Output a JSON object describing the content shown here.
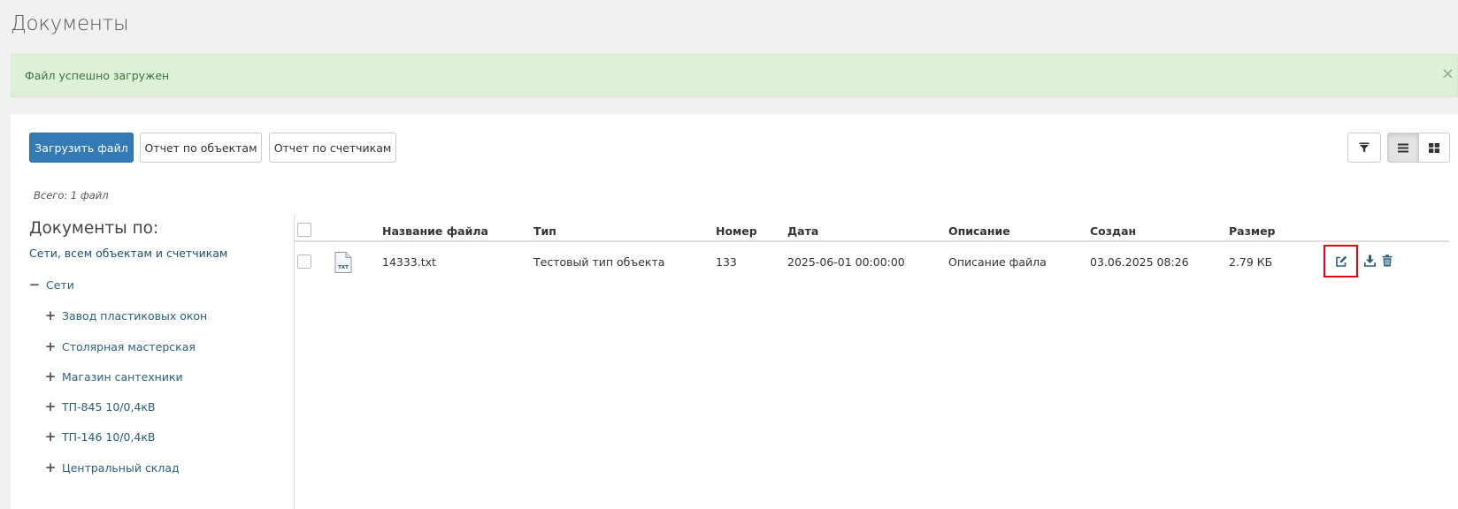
{
  "page": {
    "title": "Документы"
  },
  "alert": {
    "message": "Файл успешно загружен",
    "close": "×"
  },
  "toolbar": {
    "upload_label": "Загрузить файл",
    "report_objects_label": "Отчет по объектам",
    "report_counters_label": "Отчет по счетчикам"
  },
  "summary": {
    "total": "Всего: 1 файл"
  },
  "sidebar": {
    "title": "Документы по:",
    "root": "Сети, всем объектам и счетчикам",
    "group": {
      "toggle": "−",
      "label": "Сети"
    },
    "children": [
      {
        "toggle": "+",
        "label": "Завод пластиковых окон"
      },
      {
        "toggle": "+",
        "label": "Столярная мастерская"
      },
      {
        "toggle": "+",
        "label": "Магазин сантехники"
      },
      {
        "toggle": "+",
        "label": "ТП-845 10/0,4кВ"
      },
      {
        "toggle": "+",
        "label": "ТП-146 10/0,4кВ"
      },
      {
        "toggle": "+",
        "label": "Центральный склад"
      }
    ]
  },
  "table": {
    "columns": [
      "Название файла",
      "Тип",
      "Номер",
      "Дата",
      "Описание",
      "Создан",
      "Размер"
    ],
    "rows": [
      {
        "icon_label": "TXT",
        "name": "14333.txt",
        "type": "Тестовый тип объекта",
        "number": "133",
        "date": "2025-06-01 00:00:00",
        "description": "Описание файла",
        "created": "03.06.2025 08:26",
        "size": "2.79 КБ"
      }
    ]
  },
  "colors": {
    "primary": "#337ab7",
    "link": "#2c5f7c",
    "alert_bg": "#dff0d8",
    "alert_text": "#3c763d",
    "highlight": "#e5000f"
  },
  "icons": {
    "filter": "filter-icon",
    "list": "list-view-icon",
    "grid": "grid-view-icon",
    "edit": "edit-icon",
    "download": "download-icon",
    "delete": "trash-icon"
  }
}
